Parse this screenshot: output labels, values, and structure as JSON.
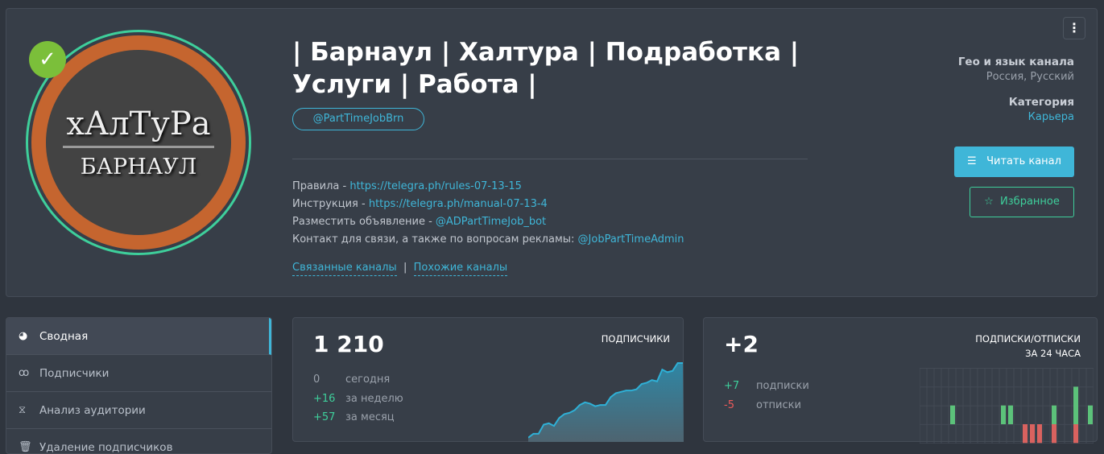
{
  "channel": {
    "title": "| Барнаул | Халтура | Подработка | Услуги | Работа |",
    "handle": "@PartTimeJobBrn",
    "logo_text": [
      "хАлТуРа",
      "БАРНАУЛ"
    ],
    "verified_icon": "check-badge-icon",
    "description": [
      {
        "label": "Правила - ",
        "link": "https://telegra.ph/rules-07-13-15"
      },
      {
        "label": "Инструкция - ",
        "link": "https://telegra.ph/manual-07-13-4"
      },
      {
        "label": "Разместить объявление - ",
        "link": "@ADPartTimeJob_bot"
      },
      {
        "label": "Контакт для связи, а также по вопросам рекламы: ",
        "link": "@JobPartTimeAdmin"
      }
    ],
    "related_link": "Связанные каналы",
    "separator": "|",
    "similar_link": "Похожие каналы",
    "geo_label": "Гео и язык канала",
    "geo_value": "Россия, Русский",
    "category_label": "Категория",
    "category_value": "Карьера",
    "read_button": "Читать канал",
    "favorite_button": "Избранное"
  },
  "sidebar": {
    "items": [
      {
        "label": "Сводная",
        "icon": "dashboard-icon",
        "active": true
      },
      {
        "label": "Подписчики",
        "icon": "users-icon"
      },
      {
        "label": "Анализ аудитории",
        "icon": "dna-icon"
      },
      {
        "label": "Удаление подписчиков",
        "icon": "trash-icon"
      }
    ]
  },
  "subscribers": {
    "total": "1 210",
    "title": "ПОДПИСЧИКИ",
    "rows": [
      {
        "value": "0",
        "label": "сегодня"
      },
      {
        "value": "+16",
        "label": "за неделю"
      },
      {
        "value": "+57",
        "label": "за месяц"
      }
    ]
  },
  "changes": {
    "total": "+2",
    "title1": "ПОДПИСКИ/ОТПИСКИ",
    "title2": "ЗА 24 ЧАСА",
    "rows": [
      {
        "value": "+7",
        "label": "подписки"
      },
      {
        "value": "-5",
        "label": "отписки"
      }
    ]
  },
  "chart_data": [
    {
      "type": "area",
      "title": "ПОДПИСЧИКИ",
      "y": [
        1153,
        1156,
        1156,
        1163,
        1164,
        1162,
        1168,
        1171,
        1172,
        1174,
        1178,
        1180,
        1179,
        1177,
        1178,
        1178,
        1184,
        1187,
        1188,
        1189,
        1189,
        1190,
        1194,
        1195,
        1197,
        1196,
        1205,
        1203,
        1204,
        1210,
        1210
      ],
      "color": "#2fb0d6"
    },
    {
      "type": "bar",
      "title": "ПОДПИСКИ/ОТПИСКИ ЗА 24 ЧАСА",
      "subscribes": [
        0,
        0,
        0,
        0,
        1,
        0,
        0,
        0,
        0,
        0,
        0,
        1,
        1,
        0,
        0,
        0,
        0,
        0,
        1,
        0,
        0,
        2,
        0,
        1
      ],
      "unsubscribes": [
        0,
        0,
        0,
        0,
        0,
        0,
        0,
        0,
        0,
        0,
        0,
        0,
        0,
        0,
        1,
        1,
        1,
        0,
        1,
        0,
        0,
        1,
        0,
        0
      ],
      "ylim": [
        -1,
        3
      ],
      "colors": {
        "sub": "#5cc27a",
        "unsub": "#d9625f"
      }
    }
  ]
}
